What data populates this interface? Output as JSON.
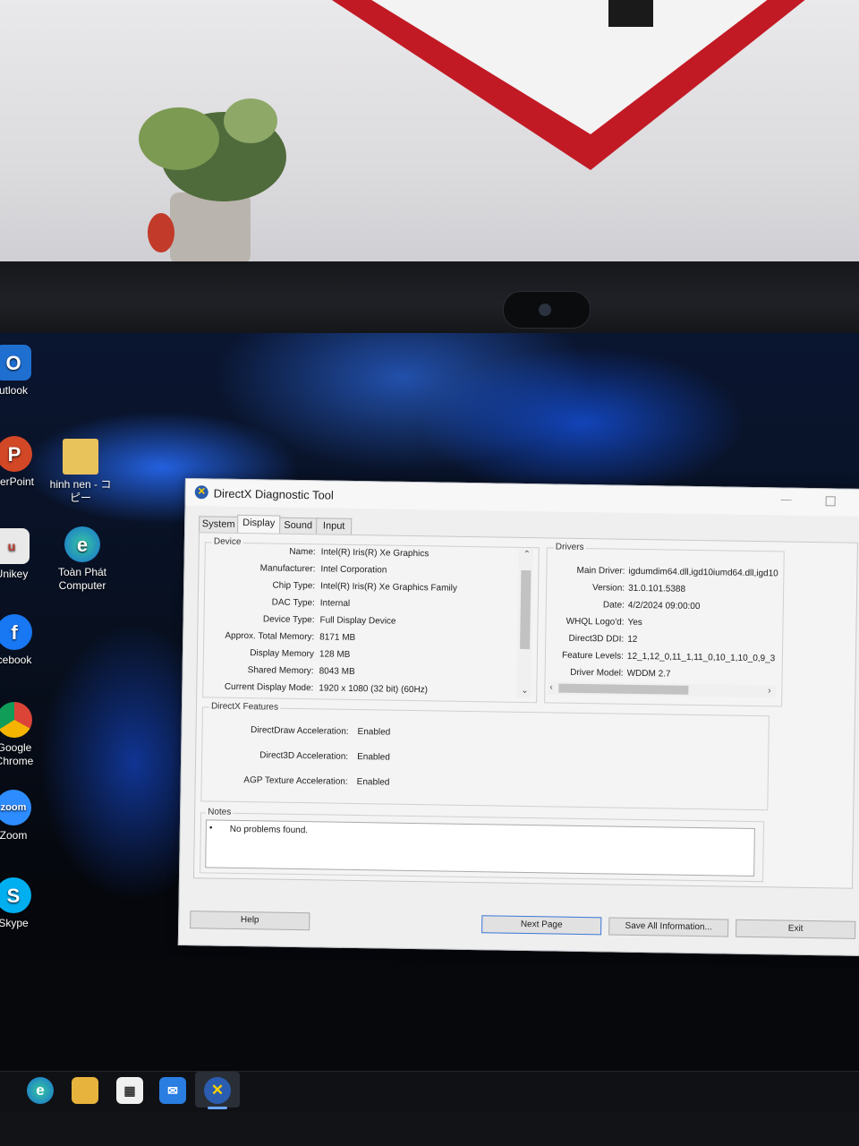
{
  "desktop": {
    "icons": [
      {
        "label": "utlook"
      },
      {
        "label": "verPoint"
      },
      {
        "label": "hinh nen - コピー"
      },
      {
        "label": "Unikey"
      },
      {
        "label": "Toàn Phát Computer"
      },
      {
        "label": "cebook"
      },
      {
        "label": "Google Chrome"
      },
      {
        "label": "Zoom"
      },
      {
        "label": "Skype"
      }
    ]
  },
  "dialog": {
    "title": "DirectX Diagnostic Tool",
    "tabs": [
      "System",
      "Display",
      "Sound",
      "Input"
    ],
    "active_tab": "Display",
    "device": {
      "label": "Device",
      "rows": [
        {
          "key": "Name:",
          "value": "Intel(R) Iris(R) Xe Graphics"
        },
        {
          "key": "Manufacturer:",
          "value": "Intel Corporation"
        },
        {
          "key": "Chip Type:",
          "value": "Intel(R) Iris(R) Xe Graphics Family"
        },
        {
          "key": "DAC Type:",
          "value": "Internal"
        },
        {
          "key": "Device Type:",
          "value": "Full Display Device"
        },
        {
          "key": "Approx. Total Memory:",
          "value": "8171 MB"
        },
        {
          "key": "Display Memory",
          "value": "128 MB"
        },
        {
          "key": "Shared Memory:",
          "value": "8043 MB"
        },
        {
          "key": "Current Display Mode:",
          "value": "1920 x 1080 (32 bit) (60Hz)"
        }
      ]
    },
    "drivers": {
      "label": "Drivers",
      "rows": [
        {
          "key": "Main Driver:",
          "value": "igdumdim64.dll,igd10iumd64.dll,igd10"
        },
        {
          "key": "Version:",
          "value": "31.0.101.5388"
        },
        {
          "key": "Date:",
          "value": "4/2/2024 09:00:00"
        },
        {
          "key": "WHQL Logo'd:",
          "value": "Yes"
        },
        {
          "key": "Direct3D DDI:",
          "value": "12"
        },
        {
          "key": "Feature Levels:",
          "value": "12_1,12_0,11_1,11_0,10_1,10_0,9_3"
        },
        {
          "key": "Driver Model:",
          "value": "WDDM 2.7"
        }
      ]
    },
    "features": {
      "label": "DirectX Features",
      "rows": [
        {
          "key": "DirectDraw Acceleration:",
          "value": "Enabled"
        },
        {
          "key": "Direct3D Acceleration:",
          "value": "Enabled"
        },
        {
          "key": "AGP Texture Acceleration:",
          "value": "Enabled"
        }
      ]
    },
    "notes": {
      "label": "Notes",
      "items": [
        "No problems found."
      ]
    },
    "buttons": {
      "help": "Help",
      "next_page": "Next Page",
      "save_all": "Save All Information...",
      "exit": "Exit"
    }
  },
  "colors": {
    "accent": "#3b78d8",
    "wallpaper_blue": "#1f5fe0"
  }
}
